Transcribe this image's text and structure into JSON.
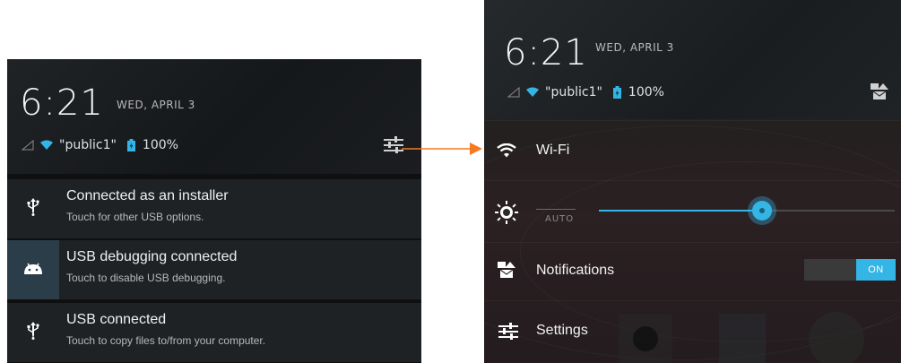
{
  "left_panel": {
    "clock": "6:21",
    "date": "WED, APRIL 3",
    "network": "\"public1\"",
    "battery": "100%",
    "notifications": [
      {
        "title": "Connected as an installer",
        "subtitle": "Touch for other USB options.",
        "icon": "usb-icon"
      },
      {
        "title": "USB debugging connected",
        "subtitle": "Touch to disable USB debugging.",
        "icon": "android-icon"
      },
      {
        "title": "USB connected",
        "subtitle": "Touch to copy files to/from your computer.",
        "icon": "usb-icon"
      }
    ]
  },
  "right_panel": {
    "clock": "6:21",
    "date": "WED, APRIL 3",
    "network": "\"public1\"",
    "battery": "100%",
    "wifi_label": "Wi-Fi",
    "brightness": {
      "auto_label": "AUTO",
      "level": 0.55
    },
    "notifications_label": "Notifications",
    "notifications_toggle": "ON",
    "settings_label": "Settings"
  },
  "colors": {
    "accent": "#33b5e5",
    "arrow": "#f47920",
    "notification_bg": "#1f2225",
    "debug_icon_bg": "#2b3d49"
  }
}
